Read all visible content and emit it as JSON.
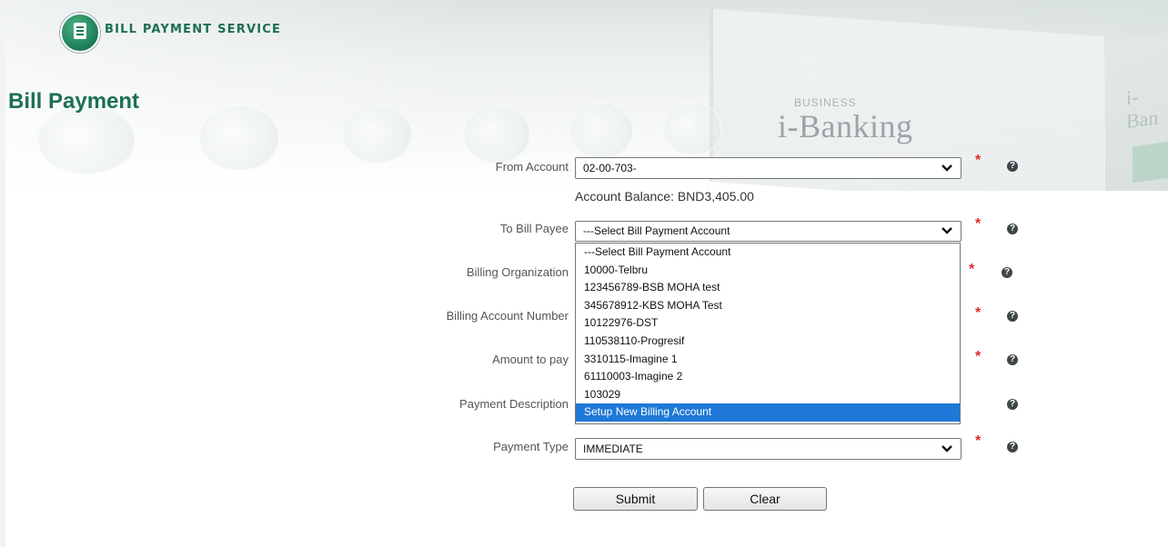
{
  "header": {
    "service_name": "BILL PAYMENT SERVICE",
    "logo_icon": "bill-document-icon"
  },
  "banner": {
    "brand_sub": "BUSINESS",
    "brand_name": "i-Banking",
    "right_brand": "i-Ban"
  },
  "page_title": "Bill Payment",
  "form": {
    "from_account": {
      "label": "From Account",
      "value": "02-00-703-"
    },
    "account_balance": "Account Balance: BND3,405.00",
    "to_bill_payee": {
      "label": "To Bill Payee",
      "value": "---Select Bill Payment Account",
      "options": [
        "---Select Bill Payment Account",
        "10000-Telbru",
        "123456789-BSB MOHA test",
        "345678912-KBS MOHA Test",
        "10122976-DST",
        "110538110-Progresif",
        "3310115-Imagine 1",
        "61110003-Imagine 2",
        "103029",
        "Setup New Billing Account"
      ],
      "highlighted_option": "Setup New Billing Account"
    },
    "billing_organization": {
      "label": "Billing Organization"
    },
    "billing_account_number": {
      "label": "Billing Account Number"
    },
    "amount_to_pay": {
      "label": "Amount to pay"
    },
    "payment_description": {
      "label": "Payment Description"
    },
    "payment_type": {
      "label": "Payment Type",
      "value": "IMMEDIATE"
    },
    "required_marker": "*",
    "help_icon_text": "?",
    "submit_label": "Submit",
    "clear_label": "Clear"
  },
  "colors": {
    "brand_green": "#1c7150",
    "required_red": "#e52727",
    "highlight_blue": "#1e78d7"
  }
}
